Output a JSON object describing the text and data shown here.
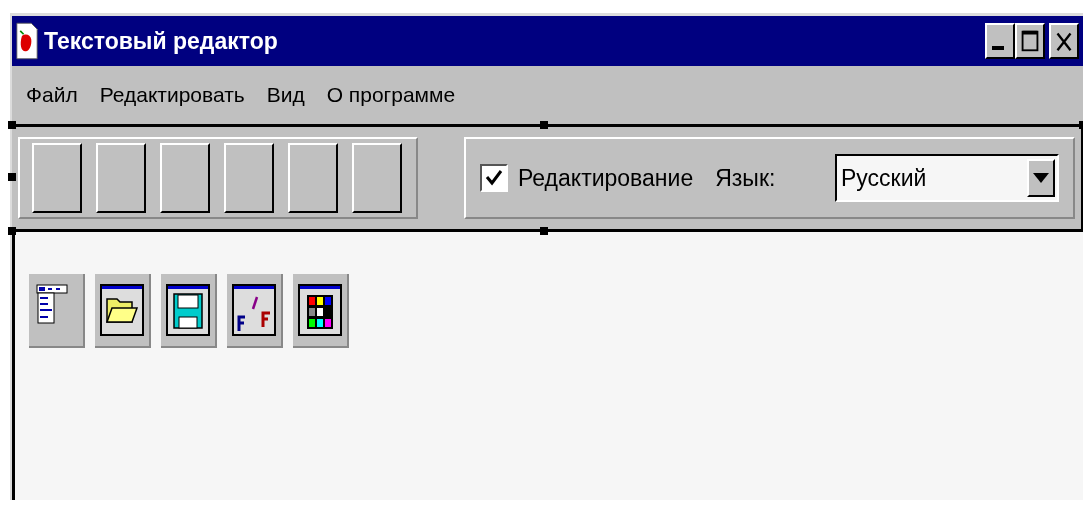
{
  "window": {
    "title": "Текстовый редактор"
  },
  "menu": [
    "Файл",
    "Редактировать",
    "Вид",
    "О программе"
  ],
  "toolbar": {
    "buttons": [
      {
        "kind": "blank"
      },
      {
        "kind": "blank"
      },
      {
        "kind": "blank"
      },
      {
        "kind": "blank"
      },
      {
        "kind": "blank"
      },
      {
        "kind": "blank"
      }
    ],
    "checkbox": {
      "label": "Редактирование",
      "checked": true
    },
    "language_label": "Язык:",
    "language_select": {
      "value": "Русский"
    }
  },
  "components": [
    {
      "kind": "menu"
    },
    {
      "kind": "open"
    },
    {
      "kind": "save"
    },
    {
      "kind": "font"
    },
    {
      "kind": "color"
    }
  ]
}
